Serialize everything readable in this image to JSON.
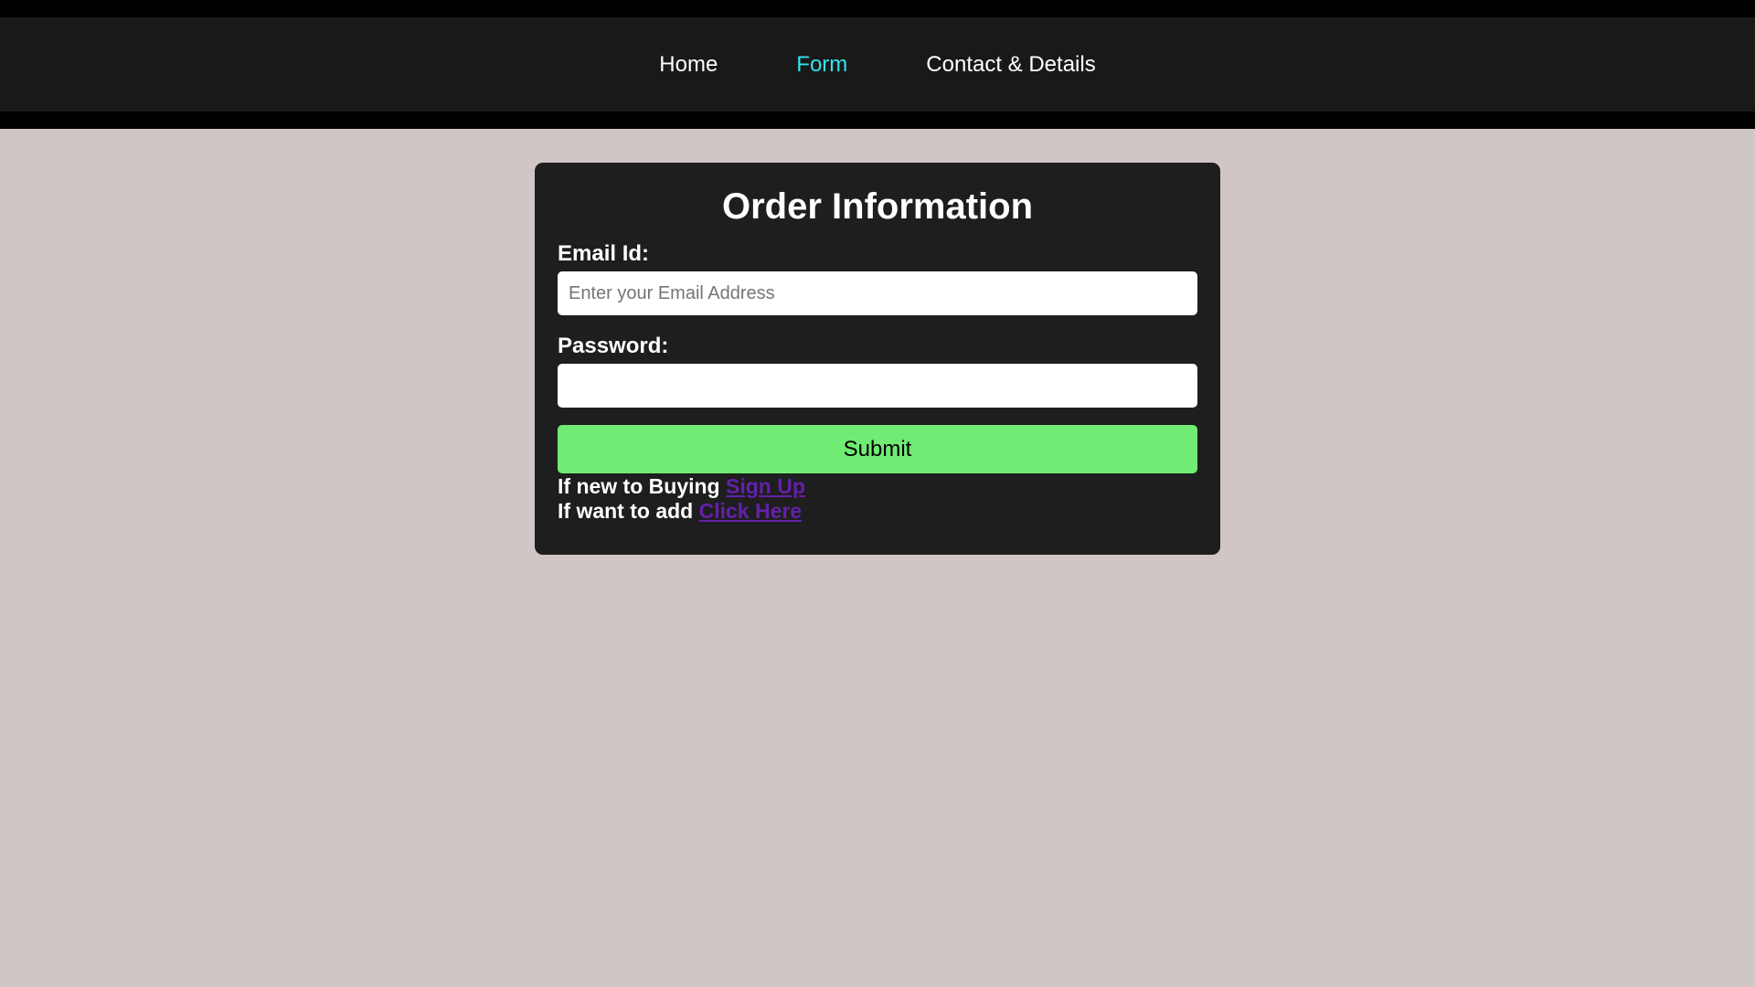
{
  "nav": {
    "items": [
      {
        "label": "Home",
        "active": false
      },
      {
        "label": "Form",
        "active": true
      },
      {
        "label": "Contact & Details",
        "active": false
      }
    ]
  },
  "form": {
    "title": "Order Information",
    "email_label": "Email Id:",
    "email_placeholder": "Enter your Email Address",
    "email_value": "",
    "password_label": "Password:",
    "password_value": "",
    "submit_label": "Submit",
    "signup_prefix": "If new to Buying",
    "signup_link": "Sign Up",
    "add_prefix": "If want to add",
    "add_link": "Click Here"
  },
  "colors": {
    "page_background": "#d0c6c5",
    "navbar_background": "#1a191a",
    "nav_active": "#32e3ef",
    "card_background": "#1e1e1e",
    "submit_background": "#71eb73",
    "link": "#6420a8"
  }
}
